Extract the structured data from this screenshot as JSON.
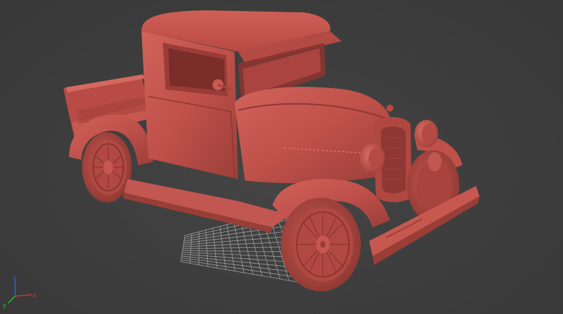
{
  "viewport": {
    "background_color": "#3d3d3d",
    "grid_color": "#bfbfbf",
    "model_color": "#c0504a",
    "model_shadow_color": "#8f3a35",
    "model_highlight_color": "#d6695f"
  },
  "axis_gizmo": {
    "x_label": "x",
    "y_label": "y",
    "z_label": "z",
    "x_color": "#e03030",
    "y_color": "#30c030",
    "z_color": "#3060e0"
  }
}
